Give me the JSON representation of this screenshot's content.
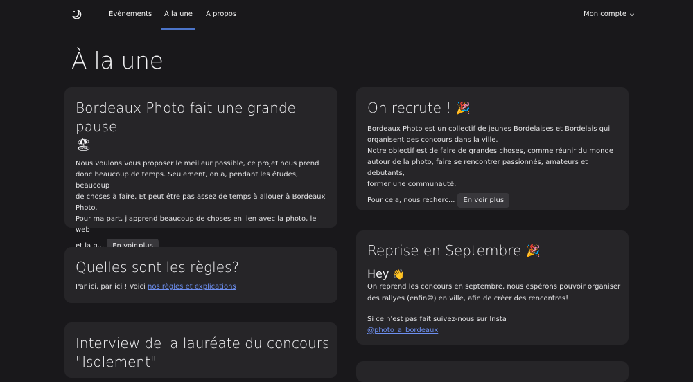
{
  "nav": {
    "logo_icon": "moon-camera-icon",
    "links": [
      "Évènements",
      "À la une",
      "À propos"
    ],
    "active": "À la une",
    "account_label": "Mon compte"
  },
  "page": {
    "title": "À la une"
  },
  "cards": {
    "pause": {
      "title": "Bordeaux Photo fait une grande pause",
      "emoji": "🏖",
      "body_lines": [
        "Nous voulons vous proposer le meilleur possible, ce projet nous prend",
        "donc beaucoup de temps. Seulement, on a, pendant les études, beaucoup",
        "de choses à faire. Et peut être pas assez de temps à allouer à Bordeaux",
        "Photo.",
        "Pour ma part, j'apprend beaucoup de choses en lien avec la photo, le web",
        "et la g..."
      ],
      "more_label": "En voir plus"
    },
    "recrute": {
      "title": "On recrute !",
      "emoji": "🎉",
      "body_lines": [
        "Bordeaux Photo est un collectif de jeunes Bordelaises et Bordelais qui",
        "organisent des concours dans la ville.",
        "Notre objectif est de faire de grandes choses, comme réunir du monde",
        "autour de la photo, faire se rencontrer passionnés, amateurs et débutants,",
        "former une communauté.",
        "Pour cela, nous recherc..."
      ],
      "more_label": "En voir plus"
    },
    "regles": {
      "title": "Quelles sont les règles?",
      "body_prefix": "Par ici, par ici ! Voici ",
      "link_text": "nos règles et explications"
    },
    "reprise": {
      "title": "Reprise en Septembre",
      "emoji": "🎉",
      "greeting": "Hey",
      "greeting_emoji": "👋",
      "line1": "On reprend les concours en septembre, nous espérons pouvoir organiser",
      "line2a": "des rallyes (enfin",
      "line2_emoji": "😊",
      "line2b": ") en ville, afin de créer des rencontres!",
      "line3": "Si ce n'est pas fait suivez-nous sur Insta",
      "insta_link": "@photo_a_bordeaux"
    },
    "interview": {
      "title_line1": "Interview de la lauréate du concours",
      "title_line2": "\"Isolement\""
    }
  },
  "colors": {
    "background": "#19181b",
    "card": "#262528",
    "accent": "#4c74c9",
    "link": "#6d8ff0"
  }
}
